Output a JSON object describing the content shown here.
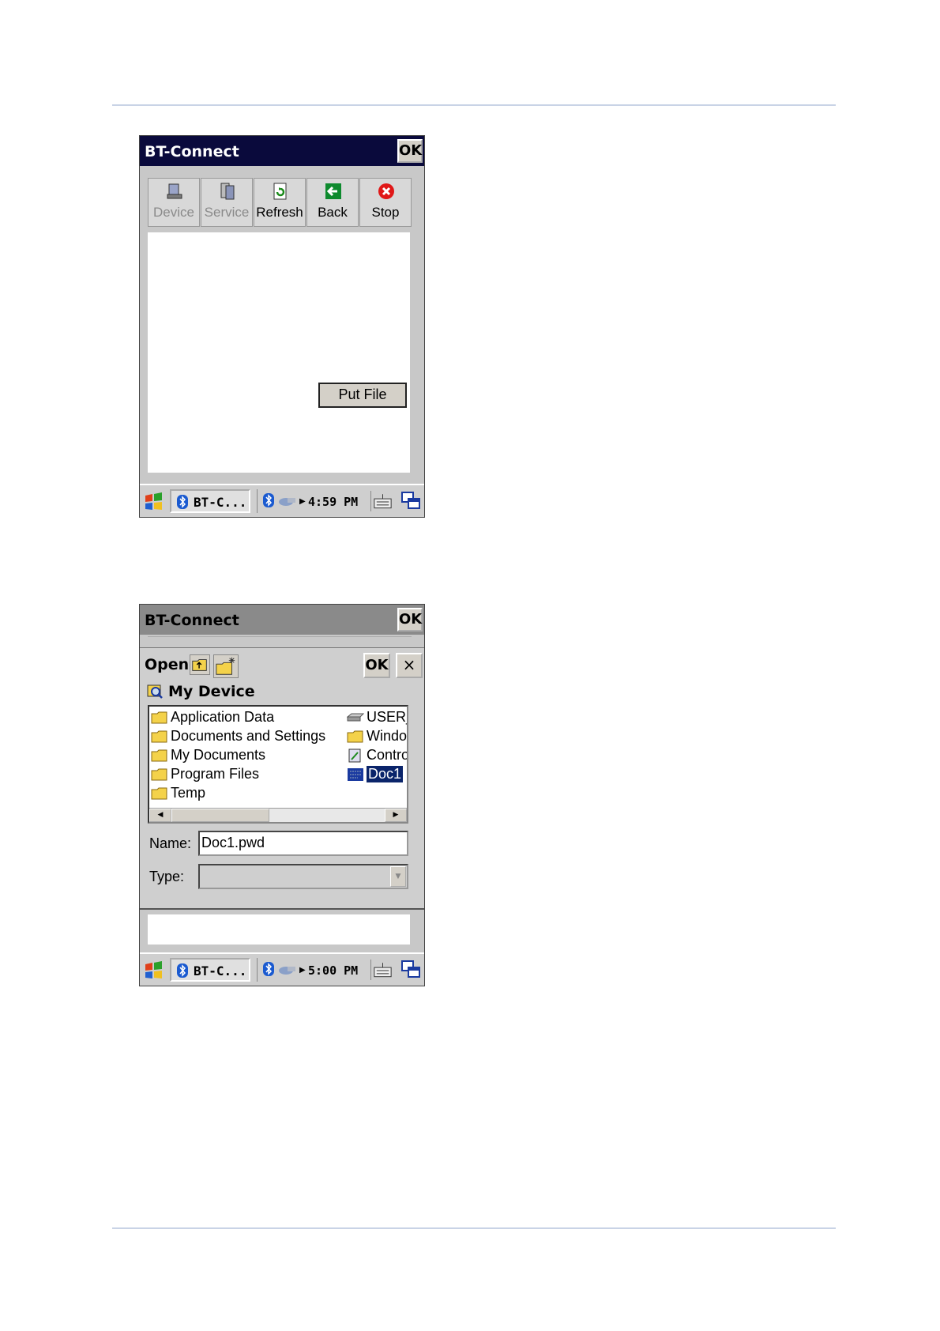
{
  "screen1": {
    "window_title": "BT-Connect",
    "ok_label": "OK",
    "toolbar": [
      {
        "label": "Device",
        "icon": "device-icon",
        "enabled": false
      },
      {
        "label": "Service",
        "icon": "service-icon",
        "enabled": false
      },
      {
        "label": "Refresh",
        "icon": "refresh-icon",
        "enabled": true
      },
      {
        "label": "Back",
        "icon": "back-arrow-icon",
        "enabled": true
      },
      {
        "label": "Stop",
        "icon": "stop-icon",
        "enabled": true
      }
    ],
    "put_file_label": "Put File",
    "taskbar": {
      "task_label": "BT-C...",
      "clock": "4:59 PM"
    }
  },
  "screen2": {
    "window_title": "BT-Connect",
    "ok_label": "OK",
    "dialog": {
      "title": "Open",
      "ok_label": "OK",
      "close_label": "×",
      "location": "My Device",
      "files_left": [
        "Application Data",
        "Documents and Settings",
        "My Documents",
        "Program Files",
        "Temp"
      ],
      "files_right": [
        "USER_",
        "Windo",
        "Contro",
        "Doc1"
      ],
      "selected": "Doc1",
      "name_label": "Name:",
      "name_value": "Doc1.pwd",
      "type_label": "Type:",
      "type_value": ""
    },
    "taskbar": {
      "task_label": "BT-C...",
      "clock": "5:00 PM"
    }
  },
  "colors": {
    "titlebar_active": "#0a0a3c",
    "titlebar_inactive": "#8a8a8a",
    "selection": "#0a246a",
    "surface": "#c8c8c8"
  }
}
